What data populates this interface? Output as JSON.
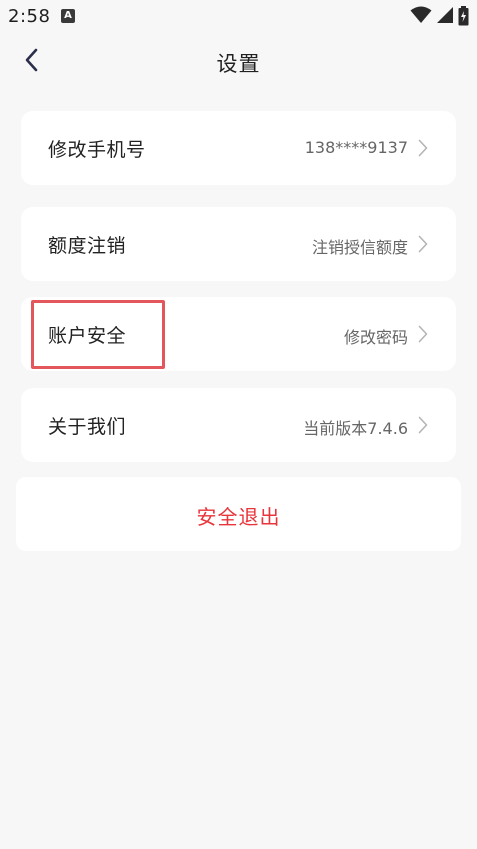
{
  "status_bar": {
    "time": "2:58",
    "notification_icon": "A"
  },
  "nav": {
    "title": "设置"
  },
  "items": [
    {
      "label": "修改手机号",
      "value": "138****9137"
    },
    {
      "label": "额度注销",
      "value": "注销授信额度"
    },
    {
      "label": "账户安全",
      "value": "修改密码"
    },
    {
      "label": "关于我们",
      "value": "当前版本7.4.6"
    }
  ],
  "logout": {
    "label": "安全退出"
  },
  "colors": {
    "background": "#f7f7f7",
    "card": "#ffffff",
    "logout_text": "#e8343b",
    "highlight": "#e3565c"
  }
}
